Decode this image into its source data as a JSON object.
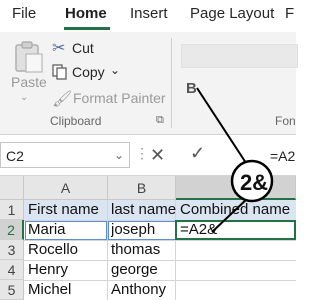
{
  "menu": {
    "tabs": [
      {
        "label": "File"
      },
      {
        "label": "Home",
        "active": true
      },
      {
        "label": "Insert"
      },
      {
        "label": "Page Layout"
      },
      {
        "label": "F"
      }
    ]
  },
  "ribbon": {
    "clipboard": {
      "paste_label": "Paste",
      "cut_label": "Cut",
      "copy_label": "Copy",
      "format_painter_label": "Format Painter",
      "group_label": "Clipboard"
    },
    "font_group_label": "Fon",
    "bold_label": "B"
  },
  "formula_bar": {
    "name_box": "C2",
    "cancel_symbol": "✕",
    "enter_symbol": "✓",
    "formula": "=A2"
  },
  "magnifier": {
    "text": "2&"
  },
  "sheet": {
    "columns": [
      "A",
      "B"
    ],
    "rows": [
      "1",
      "2",
      "3",
      "4",
      "5"
    ],
    "headers": {
      "a": "First name",
      "b": "last name",
      "c": "Combined name"
    },
    "data": [
      {
        "first": "Maria",
        "last": "joseph",
        "combined": "=A2&"
      },
      {
        "first": "Rocello",
        "last": "thomas",
        "combined": ""
      },
      {
        "first": "Henry",
        "last": "george",
        "combined": ""
      },
      {
        "first": "Michel",
        "last": "Anthony",
        "combined": ""
      }
    ]
  },
  "colors": {
    "accent": "#217346",
    "header_fill": "#dbe5f1",
    "ribbon_bg": "#f3f3f3"
  }
}
